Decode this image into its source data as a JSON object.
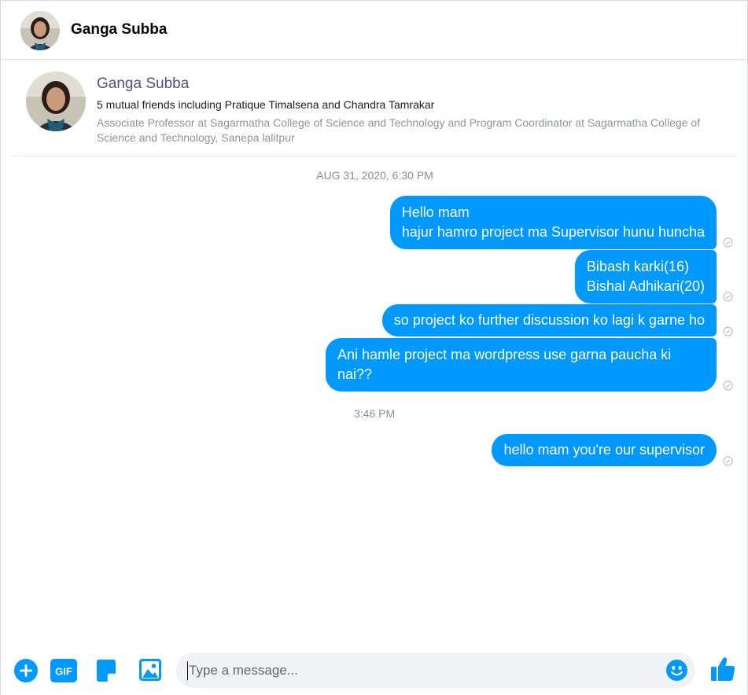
{
  "header": {
    "name": "Ganga Subba"
  },
  "profile": {
    "name": "Ganga Subba",
    "mutual_friends": "5 mutual friends including Pratique Timalsena and Chandra Tamrakar",
    "work": "Associate Professor at Sagarmatha College of Science and Technology and Program Coordinator at Sagarmatha College of Science and Technology, Sanepa lalitpur"
  },
  "timestamps": {
    "first": "AUG 31, 2020, 6:30 PM",
    "second": "3:46 PM"
  },
  "messages": [
    {
      "lines": [
        "Hello mam",
        "hajur hamro project ma Supervisor hunu huncha"
      ],
      "status": "sent"
    },
    {
      "lines": [
        "Bibash karki(16)",
        "Bishal Adhikari(20)"
      ],
      "status": "sent"
    },
    {
      "lines": [
        "so project ko further discussion ko lagi k garne ho"
      ],
      "status": "sent"
    },
    {
      "lines": [
        "Ani hamle project ma wordpress use garna paucha ki nai??"
      ],
      "status": "sent"
    },
    {
      "lines": [
        "hello mam you're our supervisor"
      ],
      "status": "sent"
    }
  ],
  "composer": {
    "placeholder": "Type a message...",
    "gif_label": "GIF",
    "icons": [
      "plus-icon",
      "gif-icon",
      "sticker-icon",
      "photo-icon",
      "emoji-icon",
      "thumbs-up-icon"
    ]
  },
  "colors": {
    "accent": "#0099ff",
    "bubble_text": "#ffffff",
    "profile_name": "#4b4f8c",
    "muted": "#8a8d91"
  }
}
